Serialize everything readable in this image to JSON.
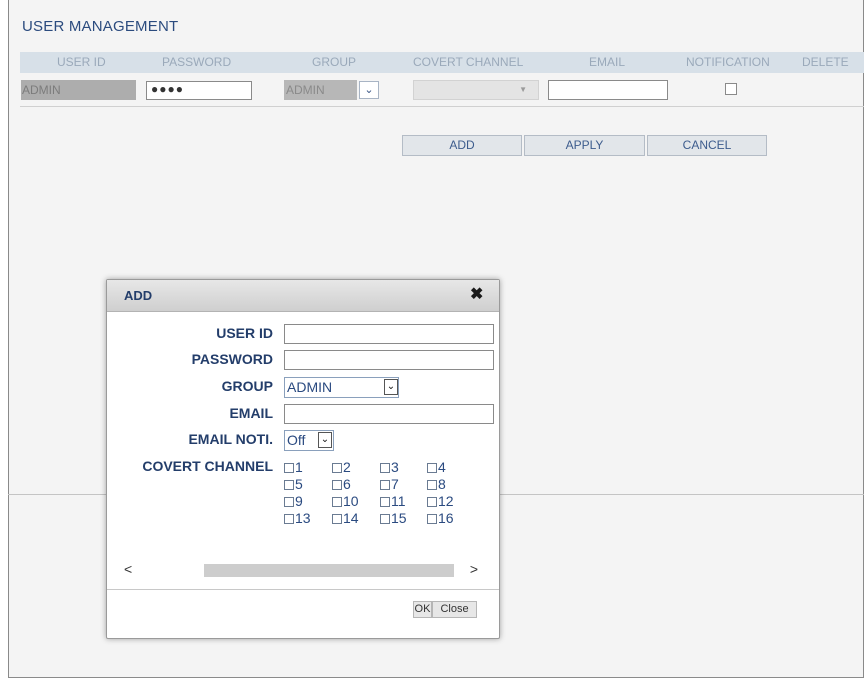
{
  "page": {
    "title": "USER MANAGEMENT"
  },
  "table": {
    "headers": [
      "USER ID",
      "PASSWORD",
      "GROUP",
      "COVERT CHANNEL",
      "EMAIL",
      "NOTIFICATION",
      "DELETE"
    ],
    "row": {
      "user_id": "ADMIN",
      "password": "●●●●",
      "group": "ADMIN",
      "group_arrow": "⌄",
      "covert_arrow": "▼",
      "email": "",
      "notification_checked": false
    }
  },
  "buttons": {
    "add": "ADD",
    "apply": "APPLY",
    "cancel": "CANCEL"
  },
  "dialog": {
    "title": "ADD",
    "close_glyph": "✖",
    "labels": {
      "user_id": "USER ID",
      "password": "PASSWORD",
      "group": "GROUP",
      "email": "EMAIL",
      "email_noti": "EMAIL NOTI.",
      "covert_channel": "COVERT CHANNEL"
    },
    "group_value": "ADMIN",
    "email_noti_value": "Off",
    "select_arrow": "⌄",
    "channels": [
      "1",
      "2",
      "3",
      "4",
      "5",
      "6",
      "7",
      "8",
      "9",
      "10",
      "11",
      "12",
      "13",
      "14",
      "15",
      "16"
    ],
    "scroll_left": "<",
    "scroll_right": ">",
    "ok_label": "OK",
    "close_label": "Close"
  },
  "colors": {
    "accent_text": "#233d6a",
    "header_bg": "#d7e0e8",
    "header_text": "#9aa9ba"
  }
}
